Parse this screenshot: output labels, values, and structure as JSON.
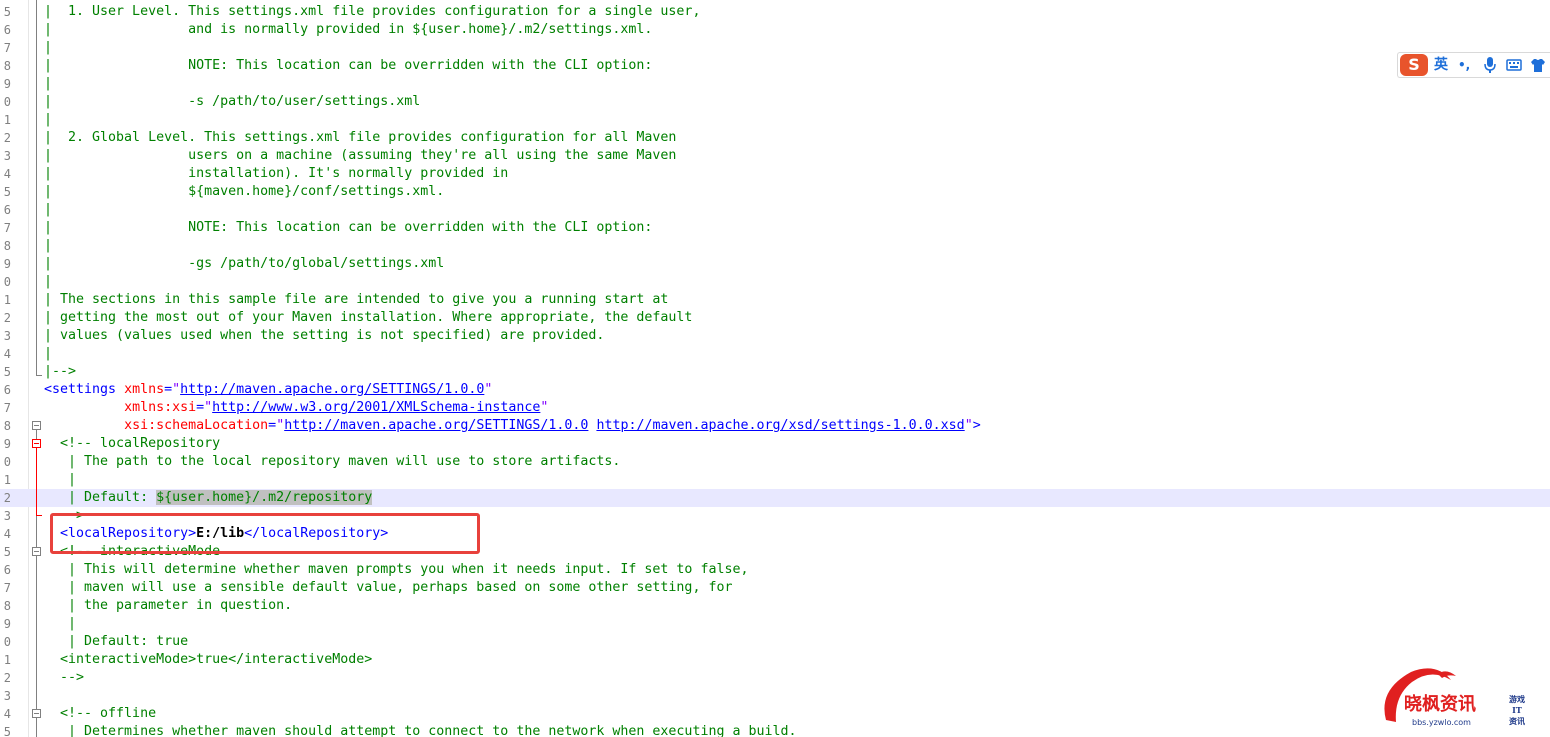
{
  "editor": {
    "lines": [
      {
        "n": "5",
        "segs": [
          [
            "c",
            "|  1. User Level. This settings.xml file provides configuration for a single user,"
          ]
        ]
      },
      {
        "n": "6",
        "segs": [
          [
            "c",
            "|                 and is normally provided in ${user.home}/.m2/settings.xml."
          ]
        ]
      },
      {
        "n": "7",
        "segs": [
          [
            "c",
            "|"
          ]
        ]
      },
      {
        "n": "8",
        "segs": [
          [
            "c",
            "|                 NOTE: This location can be overridden with the CLI option:"
          ]
        ]
      },
      {
        "n": "9",
        "segs": [
          [
            "c",
            "|"
          ]
        ]
      },
      {
        "n": "0",
        "segs": [
          [
            "c",
            "|                 -s /path/to/user/settings.xml"
          ]
        ]
      },
      {
        "n": "1",
        "segs": [
          [
            "c",
            "|"
          ]
        ]
      },
      {
        "n": "2",
        "segs": [
          [
            "c",
            "|  2. Global Level. This settings.xml file provides configuration for all Maven"
          ]
        ]
      },
      {
        "n": "3",
        "segs": [
          [
            "c",
            "|                 users on a machine (assuming they're all using the same Maven"
          ]
        ]
      },
      {
        "n": "4",
        "segs": [
          [
            "c",
            "|                 installation). It's normally provided in"
          ]
        ]
      },
      {
        "n": "5",
        "segs": [
          [
            "c",
            "|                 ${maven.home}/conf/settings.xml."
          ]
        ]
      },
      {
        "n": "6",
        "segs": [
          [
            "c",
            "|"
          ]
        ]
      },
      {
        "n": "7",
        "segs": [
          [
            "c",
            "|                 NOTE: This location can be overridden with the CLI option:"
          ]
        ]
      },
      {
        "n": "8",
        "segs": [
          [
            "c",
            "|"
          ]
        ]
      },
      {
        "n": "9",
        "segs": [
          [
            "c",
            "|                 -gs /path/to/global/settings.xml"
          ]
        ]
      },
      {
        "n": "0",
        "segs": [
          [
            "c",
            "|"
          ]
        ]
      },
      {
        "n": "1",
        "segs": [
          [
            "c",
            "| The sections in this sample file are intended to give you a running start at"
          ]
        ]
      },
      {
        "n": "2",
        "segs": [
          [
            "c",
            "| getting the most out of your Maven installation. Where appropriate, the default"
          ]
        ]
      },
      {
        "n": "3",
        "segs": [
          [
            "c",
            "| values (values used when the setting is not specified) are provided."
          ]
        ]
      },
      {
        "n": "4",
        "segs": [
          [
            "c",
            "|"
          ]
        ]
      },
      {
        "n": "5",
        "segs": [
          [
            "c",
            "|-->"
          ]
        ]
      },
      {
        "n": "6",
        "segs": [
          [
            "t",
            "<settings "
          ],
          [
            "a",
            "xmlns"
          ],
          [
            "t",
            "="
          ],
          [
            "s",
            "\""
          ],
          [
            "u",
            "http://maven.apache.org/SETTINGS/1.0.0"
          ],
          [
            "s",
            "\""
          ]
        ]
      },
      {
        "n": "7",
        "segs": [
          [
            "p",
            "          "
          ],
          [
            "a",
            "xmlns:xsi"
          ],
          [
            "t",
            "="
          ],
          [
            "s",
            "\""
          ],
          [
            "u",
            "http://www.w3.org/2001/XMLSchema-instance"
          ],
          [
            "s",
            "\""
          ]
        ]
      },
      {
        "n": "8",
        "segs": [
          [
            "p",
            "          "
          ],
          [
            "a",
            "xsi:schemaLocation"
          ],
          [
            "t",
            "="
          ],
          [
            "s",
            "\""
          ],
          [
            "u",
            "http://maven.apache.org/SETTINGS/1.0.0"
          ],
          [
            "s",
            " "
          ],
          [
            "u",
            "http://maven.apache.org/xsd/settings-1.0.0.xsd"
          ],
          [
            "s",
            "\""
          ],
          [
            "t",
            ">"
          ]
        ]
      },
      {
        "n": "9",
        "segs": [
          [
            "c",
            "  <!-- localRepository"
          ]
        ]
      },
      {
        "n": "0",
        "segs": [
          [
            "c",
            "   | The path to the local repository maven will use to store artifacts."
          ]
        ]
      },
      {
        "n": "1",
        "segs": [
          [
            "c",
            "   |"
          ]
        ]
      },
      {
        "n": "2",
        "segs": [
          [
            "c",
            "   | Default: "
          ],
          [
            "sel",
            "${user.home}/.m2/repository"
          ]
        ]
      },
      {
        "n": "3",
        "segs": [
          [
            "c",
            "  -->"
          ]
        ]
      },
      {
        "n": "4",
        "segs": [
          [
            "p",
            "  "
          ],
          [
            "t",
            "<localRepository>"
          ],
          [
            "b",
            "E:/lib"
          ],
          [
            "t",
            "</localRepository>"
          ]
        ]
      },
      {
        "n": "5",
        "segs": [
          [
            "c",
            "  <!-- interactiveMode"
          ]
        ]
      },
      {
        "n": "6",
        "segs": [
          [
            "c",
            "   | This will determine whether maven prompts you when it needs input. If set to false,"
          ]
        ]
      },
      {
        "n": "7",
        "segs": [
          [
            "c",
            "   | maven will use a sensible default value, perhaps based on some other setting, for"
          ]
        ]
      },
      {
        "n": "8",
        "segs": [
          [
            "c",
            "   | the parameter in question."
          ]
        ]
      },
      {
        "n": "9",
        "segs": [
          [
            "c",
            "   |"
          ]
        ]
      },
      {
        "n": "0",
        "segs": [
          [
            "c",
            "   | Default: true"
          ]
        ]
      },
      {
        "n": "1",
        "segs": [
          [
            "c",
            "  <interactiveMode>true</interactiveMode>"
          ]
        ]
      },
      {
        "n": "2",
        "segs": [
          [
            "c",
            "  -->"
          ]
        ]
      },
      {
        "n": "3",
        "segs": [
          [
            "c",
            ""
          ]
        ]
      },
      {
        "n": "4",
        "segs": [
          [
            "c",
            "  <!-- offline"
          ]
        ]
      },
      {
        "n": "5",
        "segs": [
          [
            "c",
            "   | Determines whether maven should attempt to connect to the network when executing a build."
          ]
        ]
      }
    ],
    "highlighted_line_index": 27
  },
  "ime_toolbar": {
    "logo": "S",
    "lang": "英",
    "punct": "•,",
    "icons": [
      "microphone-icon",
      "keyboard-icon",
      "shirt-icon"
    ],
    "accent": "#1e6fd9"
  },
  "watermark": {
    "text": "晓枫资讯",
    "url": "bbs.yzwlo.com",
    "side_lines": [
      "游戏",
      "IT",
      "资讯"
    ]
  },
  "colors": {
    "comment": "#008000",
    "tag": "#0000ff",
    "attr": "#ff0000",
    "string": "#8000ff",
    "highlight_box": "#e8413c",
    "current_line": "#e8e8ff"
  }
}
